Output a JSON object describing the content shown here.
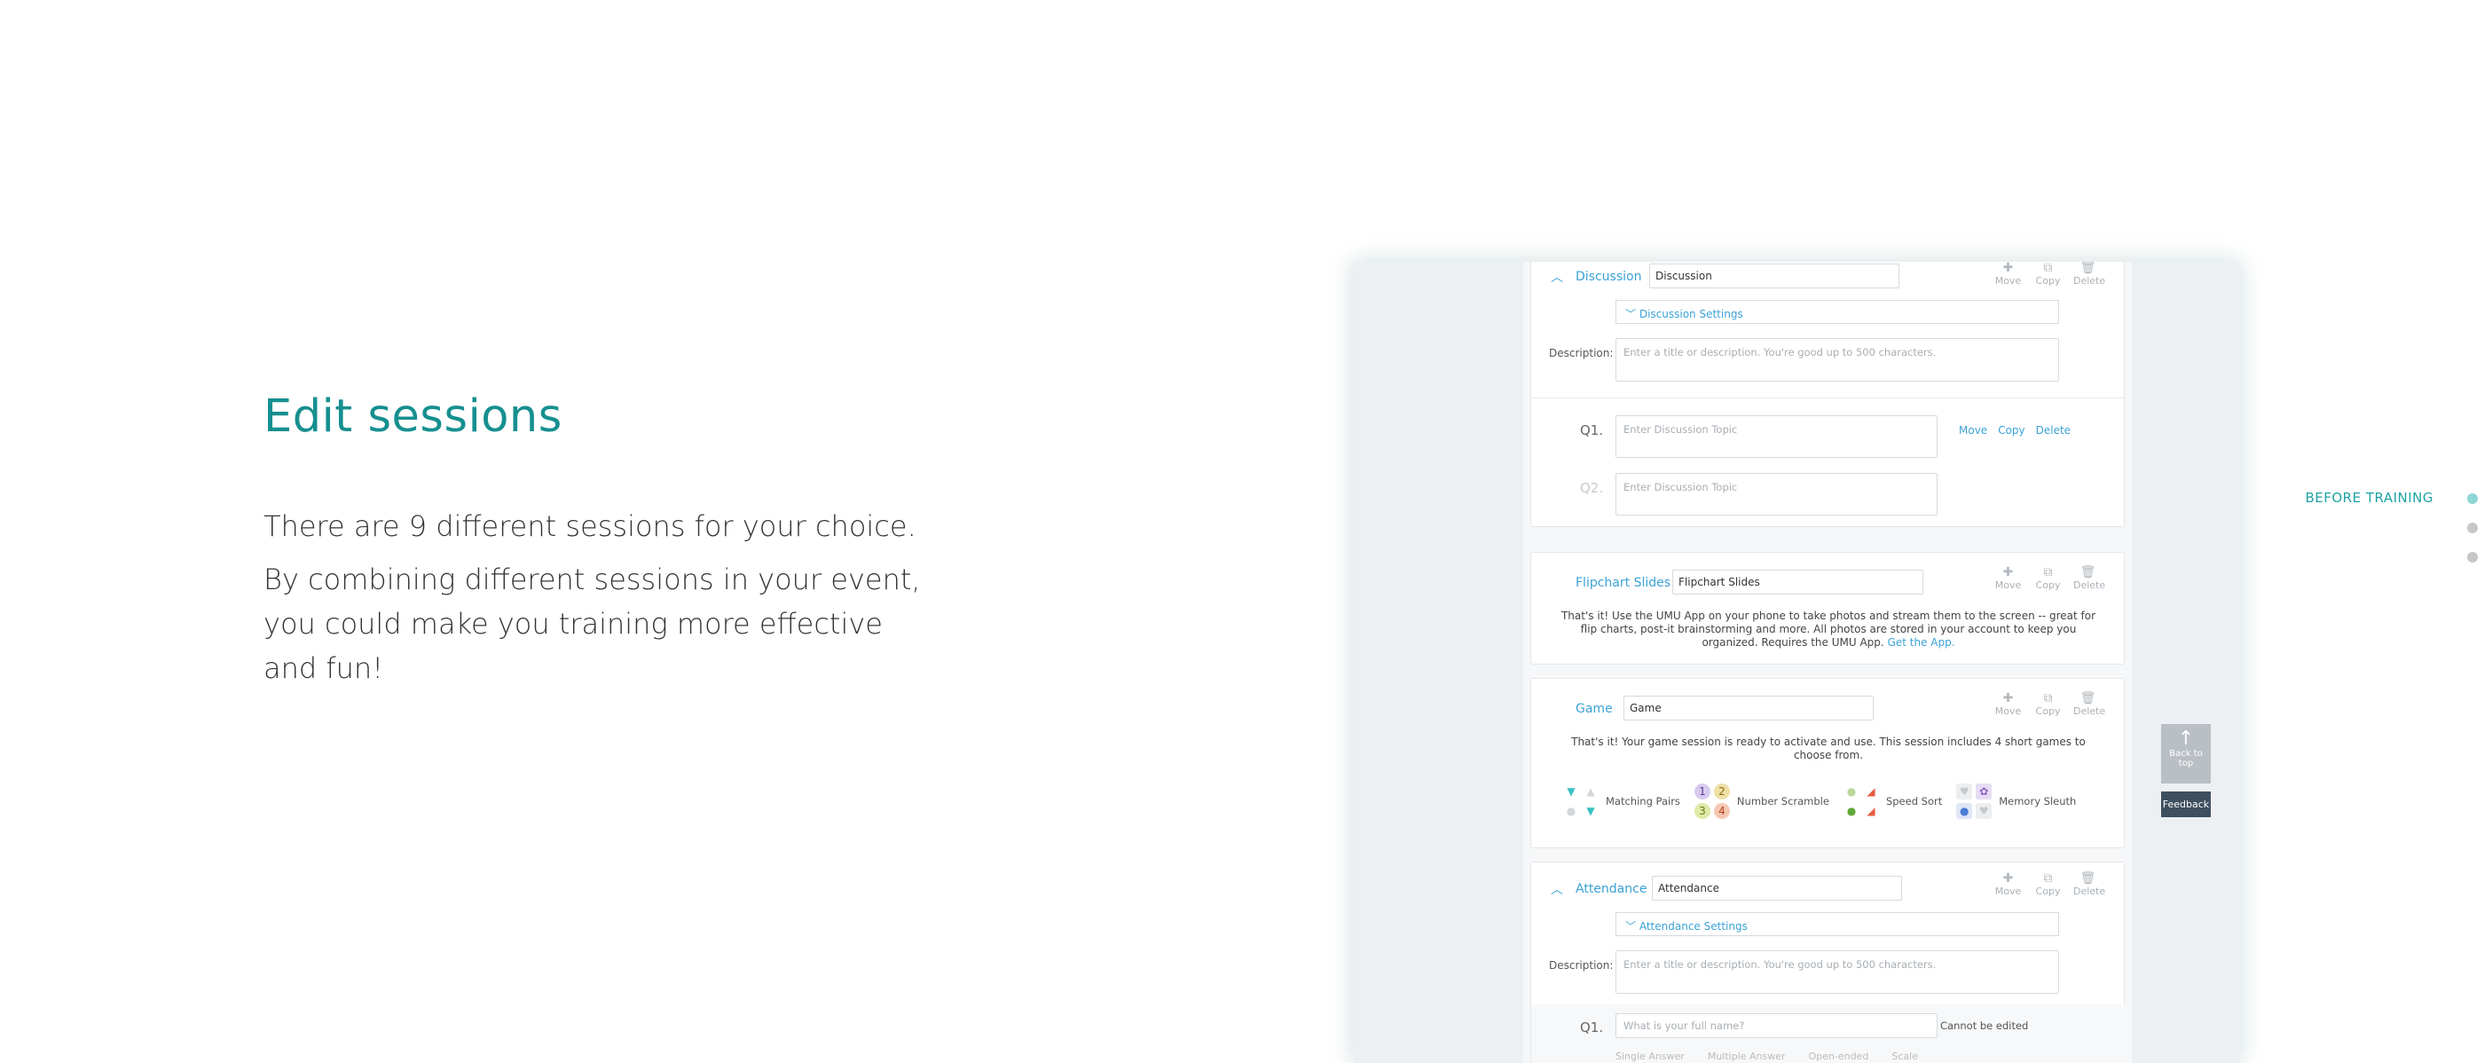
{
  "hero": {
    "title": "Edit sessions",
    "line1": "There are 9 different sessions for your choice.",
    "line2": "By combining different sessions in your event, you could make you training more effective and fun!"
  },
  "side_nav": {
    "active_label": "BEFORE TRAINING"
  },
  "actions": {
    "move": "Move",
    "copy": "Copy",
    "delete": "Delete"
  },
  "discussion": {
    "title": "Discussion",
    "name_value": "Discussion",
    "settings_label": "Discussion Settings",
    "description_label": "Description:",
    "description_placeholder": "Enter a title or description. You're good up to 500 characters.",
    "q1_label": "Q1.",
    "q1_placeholder": "Enter Discussion Topic",
    "q2_label": "Q2.",
    "q2_placeholder": "Enter Discussion Topic"
  },
  "flipchart": {
    "title": "Flipchart Slides",
    "name_value": "Flipchart Slides",
    "text": "That's it! Use the UMU App on your phone to take photos and stream them to the screen -- great for flip charts, post-it brainstorming and more. All photos are stored in your account to keep you organized. Requires the UMU App.",
    "link": "Get the App."
  },
  "game": {
    "title": "Game",
    "name_value": "Game",
    "text": "That's it! Your game session is ready to activate and use. This session includes 4 short games to choose from.",
    "games": [
      {
        "name": "Matching Pairs"
      },
      {
        "name": "Number Scramble",
        "digits": [
          "1",
          "2",
          "3",
          "4"
        ]
      },
      {
        "name": "Speed Sort"
      },
      {
        "name": "Memory Sleuth"
      }
    ]
  },
  "attendance": {
    "title": "Attendance",
    "name_value": "Attendance",
    "settings_label": "Attendance Settings",
    "description_label": "Description:",
    "description_placeholder": "Enter a title or description. You're good up to 500 characters.",
    "q1_label": "Q1.",
    "q1_placeholder": "What is your full name?",
    "q1_note": "Cannot be edited",
    "options": [
      "Single Answer",
      "Multiple Answer",
      "Open-ended",
      "Scale"
    ]
  },
  "widgets": {
    "back_to_top": "Back to top",
    "feedback": "Feedback"
  }
}
